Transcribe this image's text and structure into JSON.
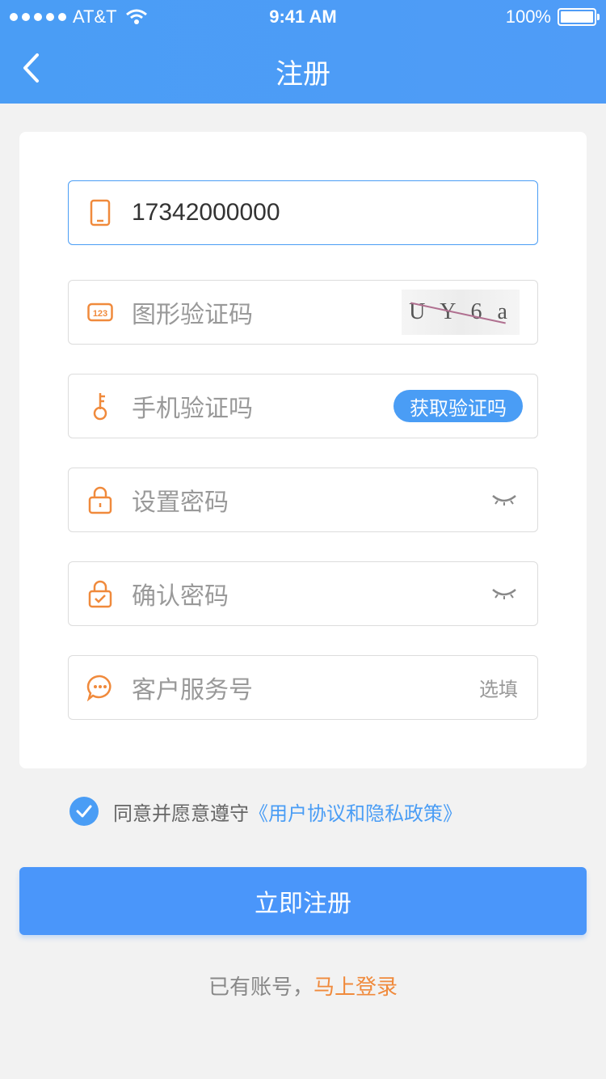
{
  "status_bar": {
    "carrier": "AT&T",
    "time": "9:41 AM",
    "battery": "100%"
  },
  "nav": {
    "title": "注册"
  },
  "form": {
    "phone": {
      "value": "17342000000"
    },
    "captcha": {
      "placeholder": "图形验证码",
      "image_text": "U Y 6 a"
    },
    "sms": {
      "placeholder": "手机验证吗",
      "button": "获取验证吗"
    },
    "password": {
      "placeholder": "设置密码"
    },
    "confirm": {
      "placeholder": "确认密码"
    },
    "service": {
      "placeholder": "客户服务号",
      "hint": "选填"
    }
  },
  "agreement": {
    "text": "同意并愿意遵守",
    "link": "《用户协议和隐私政策》",
    "checked": true
  },
  "submit": {
    "label": "立即注册"
  },
  "login": {
    "text": "已有账号，",
    "link": "马上登录"
  },
  "colors": {
    "primary": "#4a9df5",
    "accent": "#f08a3c"
  }
}
